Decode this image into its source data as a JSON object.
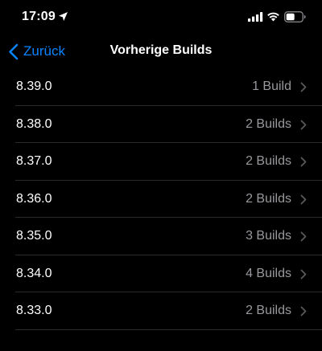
{
  "status_bar": {
    "time": "17:09",
    "icons": [
      "location-arrow-icon",
      "cellular-signal-icon",
      "wifi-icon",
      "battery-icon"
    ]
  },
  "nav": {
    "back_label": "Zurück",
    "title": "Vorherige Builds"
  },
  "colors": {
    "background": "#000000",
    "accent": "#0a84ff",
    "secondary_text": "#98989d",
    "separator": "#2a2a2c"
  },
  "builds": [
    {
      "version": "8.39.0",
      "count": "1 Build"
    },
    {
      "version": "8.38.0",
      "count": "2 Builds"
    },
    {
      "version": "8.37.0",
      "count": "2 Builds"
    },
    {
      "version": "8.36.0",
      "count": "2 Builds"
    },
    {
      "version": "8.35.0",
      "count": "3 Builds"
    },
    {
      "version": "8.34.0",
      "count": "4 Builds"
    },
    {
      "version": "8.33.0",
      "count": "2 Builds"
    }
  ]
}
